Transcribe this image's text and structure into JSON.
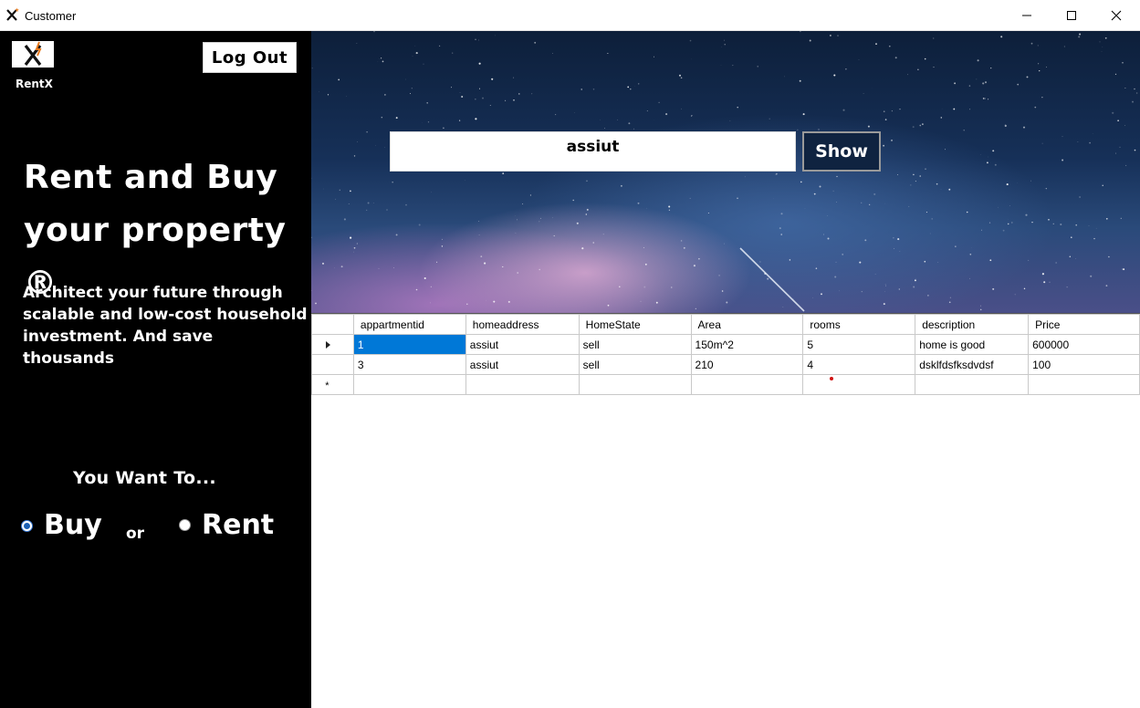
{
  "window": {
    "title": "Customer",
    "controls": [
      "minimize",
      "maximize",
      "close"
    ]
  },
  "sidebar": {
    "logo_text": "RentX",
    "logout_label": "Log Out",
    "hero_title": "Rent and Buy your property ®",
    "hero_subtitle": "Architect your future through scalable and low-cost household investment. And save thousands",
    "want_label": "You Want To...",
    "options": [
      {
        "label": "Buy",
        "selected": true
      },
      {
        "label": "Rent",
        "selected": false
      }
    ],
    "or_label": "or"
  },
  "search": {
    "value": "assiut",
    "button_label": "Show"
  },
  "grid": {
    "columns": [
      "appartmentid",
      "homeaddress",
      "HomeState",
      "Area",
      "rooms",
      "description",
      "Price"
    ],
    "rows": [
      [
        "1",
        "assiut",
        "sell",
        "150m^2",
        "5",
        "home is good",
        "600000"
      ],
      [
        "3",
        "assiut",
        "sell",
        "210",
        "4",
        "dsklfdsfksdvdsf",
        "100"
      ]
    ],
    "new_row_marker": "*"
  },
  "colors": {
    "sidebar_bg": "#000000",
    "selection": "#0078d7",
    "show_button_bg": "#0f2340"
  }
}
